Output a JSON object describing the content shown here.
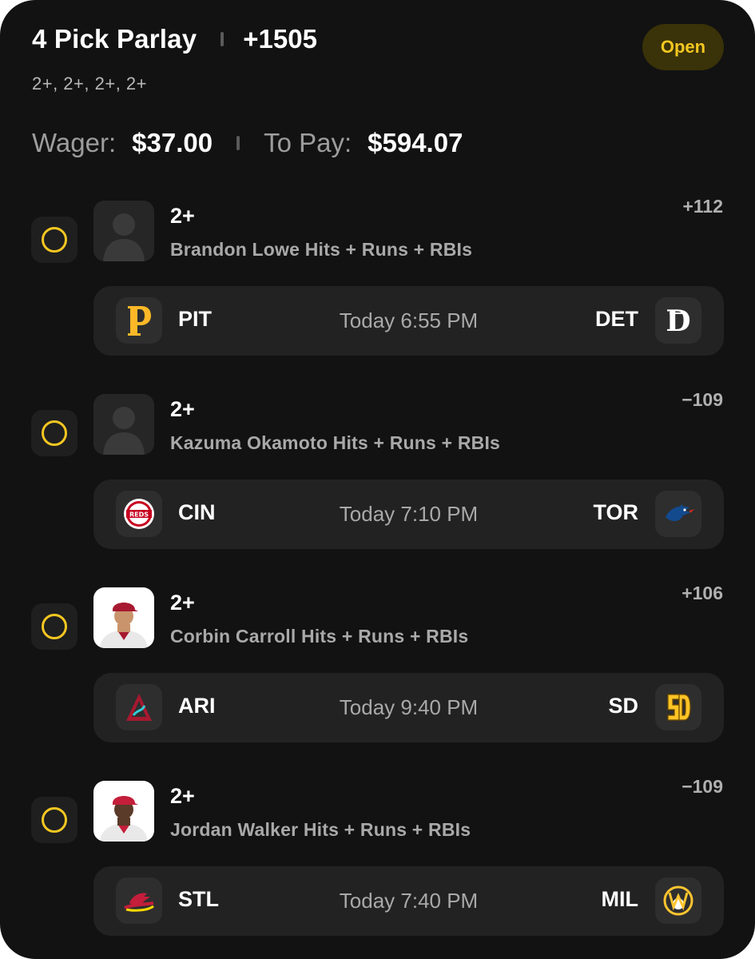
{
  "parlay": {
    "title": "4 Pick Parlay",
    "odds": "+1505",
    "status": "Open",
    "lines_summary": "2+, 2+, 2+, 2+",
    "wager_label": "Wager:",
    "wager_value": "$37.00",
    "to_pay_label": "To Pay:",
    "to_pay_value": "$594.07"
  },
  "legs": [
    {
      "line": "2+",
      "market": "Brandon Lowe Hits + Runs + RBIs",
      "odds": "+112",
      "avatar": "placeholder-silhouette",
      "game": {
        "home": "PIT",
        "away": "DET",
        "time": "Today 6:55 PM",
        "home_icon": "pirates-logo-icon",
        "away_icon": "tigers-logo-icon"
      }
    },
    {
      "line": "2+",
      "market": "Kazuma Okamoto Hits + Runs + RBIs",
      "odds": "−109",
      "avatar": "placeholder-silhouette",
      "game": {
        "home": "CIN",
        "away": "TOR",
        "time": "Today 7:10 PM",
        "home_icon": "reds-logo-icon",
        "away_icon": "blue-jays-logo-icon"
      }
    },
    {
      "line": "2+",
      "market": "Corbin Carroll Hits + Runs + RBIs",
      "odds": "+106",
      "avatar": "player-photo",
      "game": {
        "home": "ARI",
        "away": "SD",
        "time": "Today 9:40 PM",
        "home_icon": "diamondbacks-logo-icon",
        "away_icon": "padres-logo-icon"
      }
    },
    {
      "line": "2+",
      "market": "Jordan Walker Hits + Runs + RBIs",
      "odds": "−109",
      "avatar": "player-photo",
      "game": {
        "home": "STL",
        "away": "MIL",
        "time": "Today 7:40 PM",
        "home_icon": "cardinals-logo-icon",
        "away_icon": "brewers-logo-icon"
      }
    }
  ],
  "colors": {
    "background": "#121212",
    "accent": "#f5c721",
    "badge_bg": "#3a3208",
    "bar_bg": "#222222",
    "muted_text": "#a9a9a9"
  }
}
